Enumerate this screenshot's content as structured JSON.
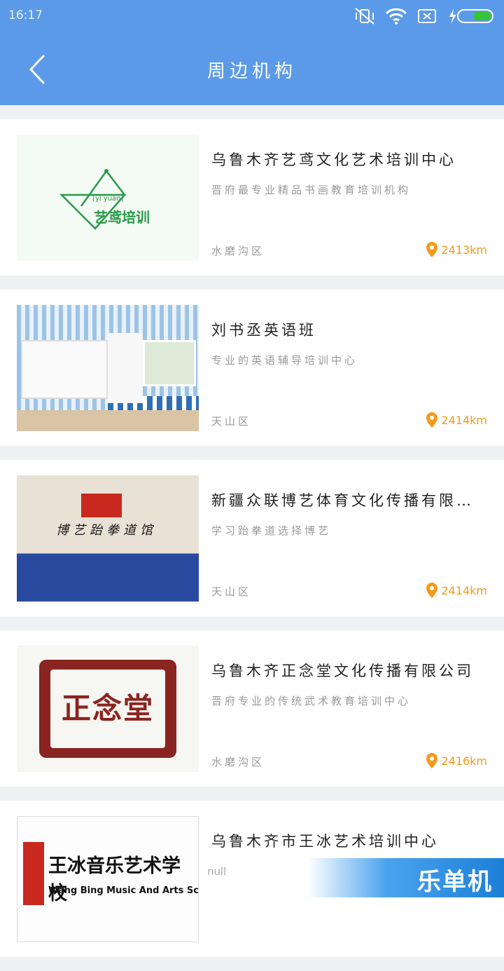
{
  "status": {
    "time": "16:17"
  },
  "header": {
    "title": "周边机构"
  },
  "items": [
    {
      "name": "乌鲁木齐艺鸢文化艺术培训中心",
      "desc": "晋府最专业精品书画教育培训机构",
      "district": "水磨沟区",
      "distance": "2413km",
      "thumb_text": "艺鸢培训",
      "thumb_pinyin": "[yì yuān]"
    },
    {
      "name": "刘书丞英语班",
      "desc": "专业的英语辅导培训中心",
      "district": "天山区",
      "distance": "2414km"
    },
    {
      "name": "新疆众联博艺体育文化传播有限…",
      "desc": "学习跆拳道选择博艺",
      "district": "天山区",
      "distance": "2414km",
      "thumb_text": "博艺跆拳道馆"
    },
    {
      "name": "乌鲁木齐正念堂文化传播有限公司",
      "desc": "晋府专业的传统武术教育培训中心",
      "district": "水磨沟区",
      "distance": "2416km",
      "thumb_text": "正念堂"
    },
    {
      "name": "乌鲁木齐市王冰艺术培训中心",
      "thumb_text": "王冰音乐艺术学校",
      "thumb_sub": "Wang Bing Music And Arts School"
    }
  ],
  "footer": {
    "null_text": "null",
    "brand": "乐单机"
  }
}
